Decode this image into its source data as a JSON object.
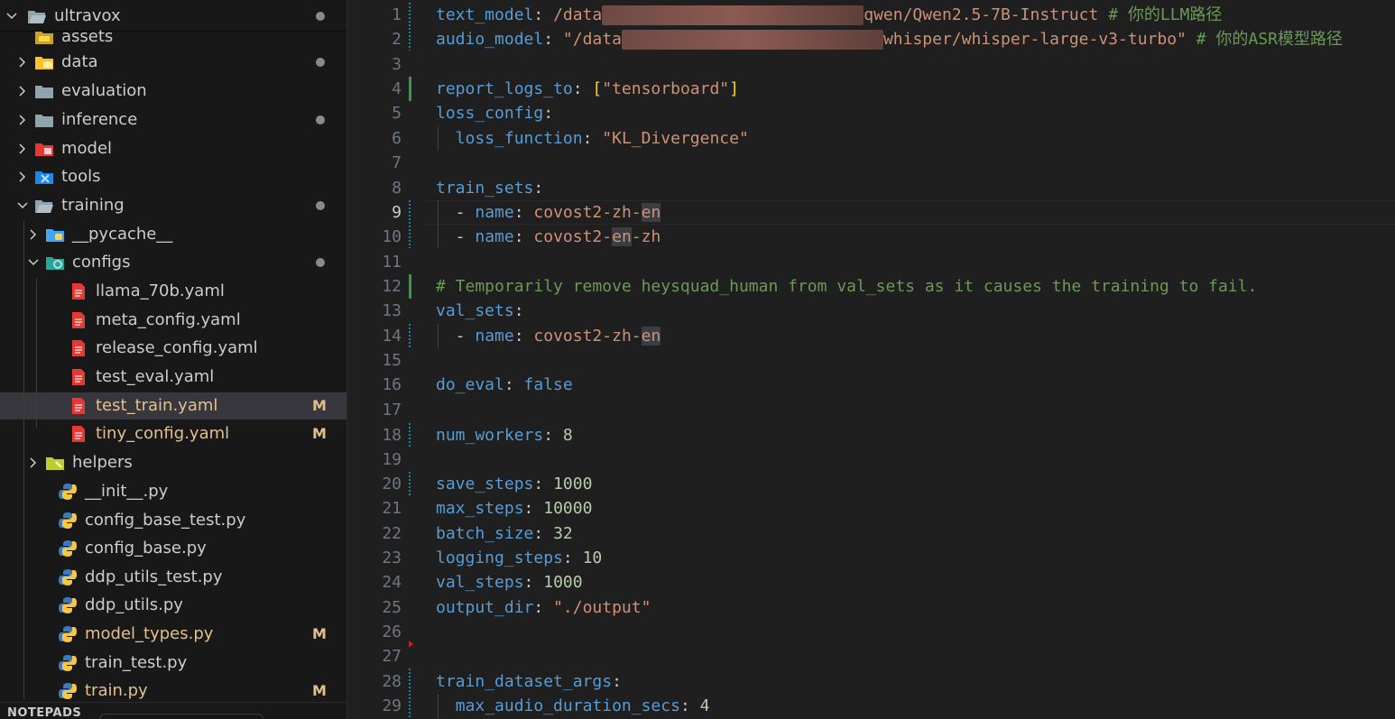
{
  "explorer": {
    "root": "ultravox",
    "items": [
      {
        "label": "assets",
        "kind": "folder"
      },
      {
        "label": "data",
        "kind": "folder"
      },
      {
        "label": "evaluation",
        "kind": "folder"
      },
      {
        "label": "inference",
        "kind": "folder"
      },
      {
        "label": "model",
        "kind": "folder"
      },
      {
        "label": "tools",
        "kind": "folder"
      },
      {
        "label": "training",
        "kind": "folder"
      },
      {
        "label": "__pycache__",
        "kind": "folder"
      },
      {
        "label": "configs",
        "kind": "folder"
      },
      {
        "label": "llama_70b.yaml",
        "kind": "yaml"
      },
      {
        "label": "meta_config.yaml",
        "kind": "yaml"
      },
      {
        "label": "release_config.yaml",
        "kind": "yaml"
      },
      {
        "label": "test_eval.yaml",
        "kind": "yaml"
      },
      {
        "label": "test_train.yaml",
        "kind": "yaml",
        "status": "M"
      },
      {
        "label": "tiny_config.yaml",
        "kind": "yaml",
        "status": "M"
      },
      {
        "label": "helpers",
        "kind": "folder"
      },
      {
        "label": "__init__.py",
        "kind": "python"
      },
      {
        "label": "config_base_test.py",
        "kind": "python"
      },
      {
        "label": "config_base.py",
        "kind": "python"
      },
      {
        "label": "ddp_utils_test.py",
        "kind": "python"
      },
      {
        "label": "ddp_utils.py",
        "kind": "python"
      },
      {
        "label": "model_types.py",
        "kind": "python",
        "status": "M"
      },
      {
        "label": "train_test.py",
        "kind": "python"
      },
      {
        "label": "train.py",
        "kind": "python",
        "status": "M"
      }
    ],
    "notepads_label": "NOTEPADS",
    "colors": {
      "modified": "#e2c08d",
      "selected_bg": "#37373d"
    }
  },
  "editor": {
    "line_numbers": [
      "1",
      "2",
      "3",
      "4",
      "5",
      "6",
      "7",
      "8",
      "9",
      "10",
      "11",
      "12",
      "13",
      "14",
      "15",
      "16",
      "17",
      "18",
      "19",
      "20",
      "21",
      "22",
      "23",
      "24",
      "25",
      "26",
      "27",
      "28",
      "29"
    ],
    "code": {
      "l1_key": "text_model",
      "l1_pre": "/data",
      "l1_post": "qwen/Qwen2.5-7B-Instruct",
      "l1_comment": "# 你的LLM路径",
      "l2_key": "audio_model",
      "l2_pre": "\"/data",
      "l2_post": "whisper/whisper-large-v3-turbo\"",
      "l2_comment": "# 你的ASR模型路径",
      "l4_key": "report_logs_to",
      "l4_val": "\"tensorboard\"",
      "l5_key": "loss_config",
      "l6_key": "loss_function",
      "l6_val": "\"KL_Divergence\"",
      "l8_key": "train_sets",
      "name_key": "name",
      "l9_a": "covost2-zh-",
      "l9_b": "en",
      "l10_a": "covost2-",
      "l10_b": "en",
      "l10_c": "-zh",
      "l12_comment": "# Temporarily remove heysquad_human from val_sets as it causes the training to fail.",
      "l13_key": "val_sets",
      "l14_a": "covost2-zh-",
      "l14_b": "en",
      "l16_key": "do_eval",
      "l16_val": "false",
      "l18_key": "num_workers",
      "l18_val": "8",
      "l20_key": "save_steps",
      "l20_val": "1000",
      "l21_key": "max_steps",
      "l21_val": "10000",
      "l22_key": "batch_size",
      "l22_val": "32",
      "l23_key": "logging_steps",
      "l23_val": "10",
      "l24_key": "val_steps",
      "l24_val": "1000",
      "l25_key": "output_dir",
      "l25_val": "\"./output\"",
      "l28_key": "train_dataset_args",
      "l29_key": "max_audio_duration_secs",
      "l29_val": "4"
    },
    "active_line": "9",
    "colors": {
      "key": "#569cd6",
      "string": "#ce9178",
      "number": "#b5cea8",
      "comment": "#6a9955",
      "bracket": "#ffd700",
      "added": "#2ea043",
      "modified": "#1b81a8"
    }
  }
}
